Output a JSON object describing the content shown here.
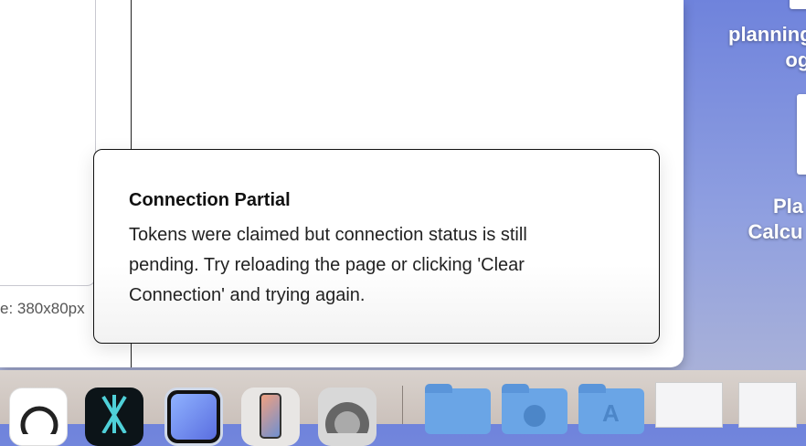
{
  "desktop": {
    "items": [
      {
        "label_line1": "planning",
        "label_line2": "og"
      },
      {
        "label_line1": "Pla",
        "label_line2": "Calcu"
      }
    ]
  },
  "window": {
    "size_text": "e: 380x80px"
  },
  "toast": {
    "title": "Connection Partial",
    "body": "Tokens were claimed but connection status is still pending. Try reloading the page or clicking 'Clear Connection' and trying again."
  },
  "dock": {
    "apps": [
      "chatgpt-icon",
      "app-icon",
      "iphone-mirroring-icon",
      "iphone-icon",
      "system-settings-icon"
    ],
    "folders": [
      "documents-folder-icon",
      "downloads-folder-icon",
      "applications-folder-icon"
    ]
  }
}
